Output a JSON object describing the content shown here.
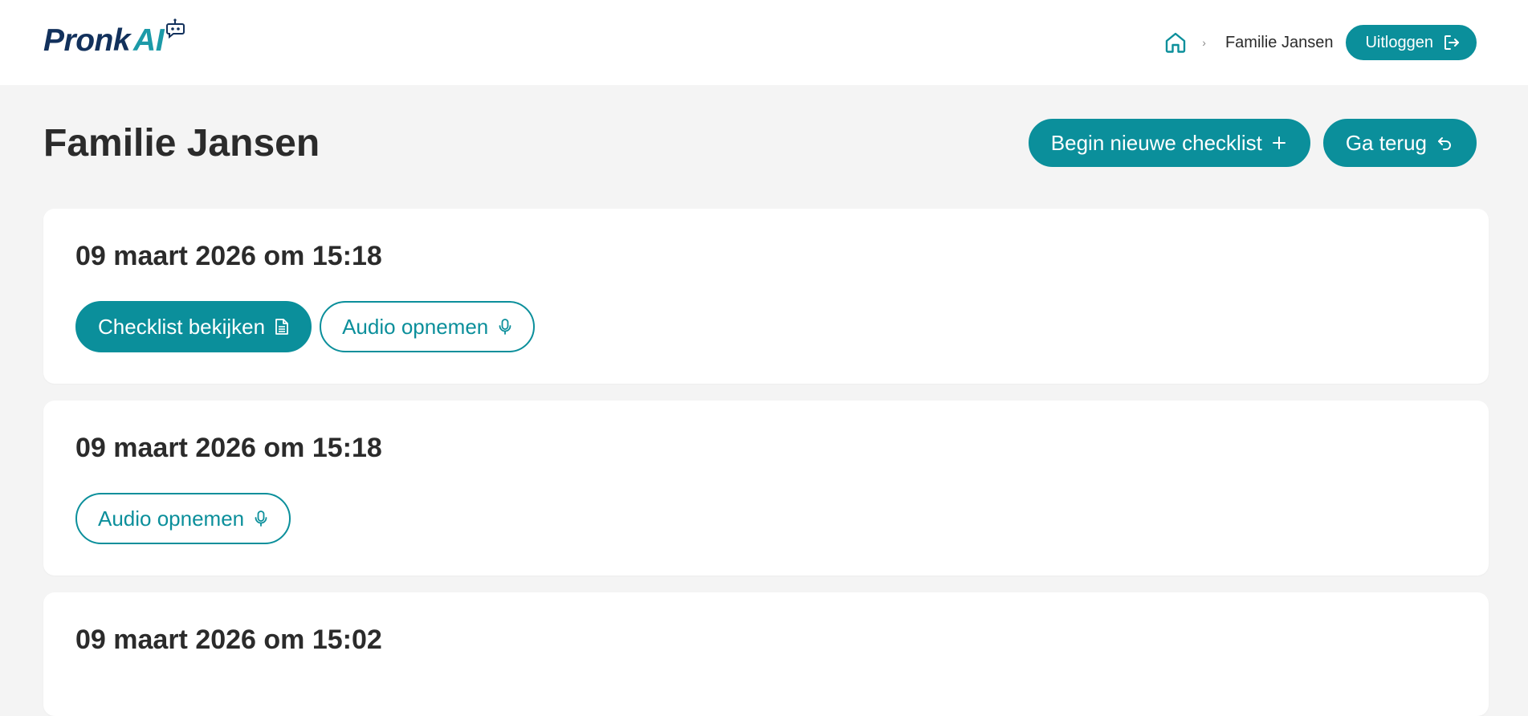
{
  "app": {
    "logo_primary": "Pronk",
    "logo_accent": "AI"
  },
  "nav": {
    "breadcrumb_current": "Familie Jansen",
    "logout_label": "Uitloggen"
  },
  "page": {
    "title": "Familie Jansen",
    "new_checklist_label": "Begin nieuwe checklist",
    "back_label": "Ga terug"
  },
  "sessions": [
    {
      "title": "09 maart 2026 om 15:18",
      "view_label": "Checklist bekijken",
      "record_label": "Audio opnemen"
    },
    {
      "title": "09 maart 2026 om 15:18",
      "record_label": "Audio opnemen"
    },
    {
      "title": "09 maart 2026 om 15:02"
    }
  ],
  "colors": {
    "accent": "#0b8f9b",
    "logo_navy": "#12315c",
    "logo_teal": "#1c9aa8",
    "background": "#f4f4f4"
  },
  "icons": {
    "home": "home-icon",
    "logout": "logout-icon",
    "plus": "plus-icon",
    "back": "undo-arrow-icon",
    "document": "document-icon",
    "microphone": "microphone-icon",
    "bot": "robot-chat-icon"
  }
}
